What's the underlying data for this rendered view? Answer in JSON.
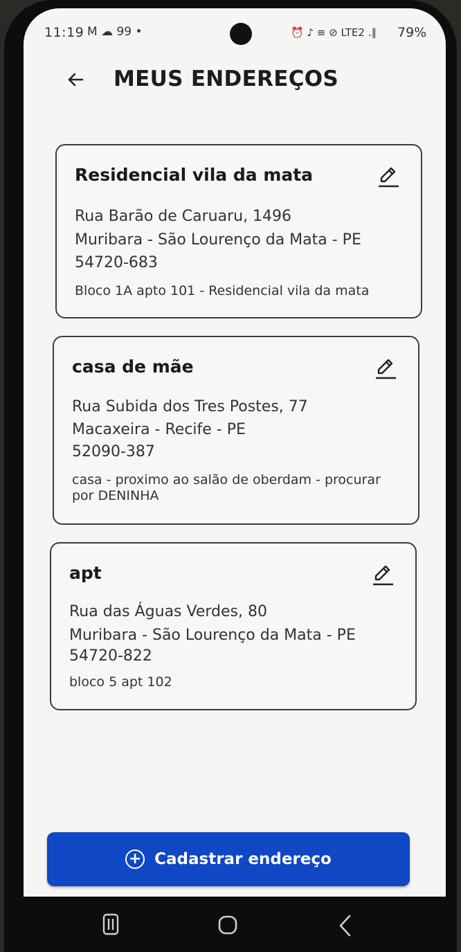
{
  "status_bar": {
    "time": "11:19",
    "notifications": "M ☁ 99 •",
    "system_icons": "⏰ ♪ ≡ ⊘ LTE2 .∥",
    "battery": "79%"
  },
  "header": {
    "title": "MEUS ENDEREÇOS"
  },
  "addresses": [
    {
      "name": "Residencial vila da mata",
      "street": "Rua Barão de Caruaru, 1496",
      "city": "Muribara - São Lourenço da Mata - PE",
      "zip": "54720-683",
      "complement": "Bloco 1A apto 101 - Residencial vila da mata"
    },
    {
      "name": "casa de mãe",
      "street": "Rua Subida dos Tres Postes, 77",
      "city": "Macaxeira - Recife - PE",
      "zip": "52090-387",
      "complement": "casa - proximo ao salão de oberdam - procurar por DENINHA"
    },
    {
      "name": "apt",
      "street": "Rua das Águas Verdes, 80",
      "city": "Muribara - São Lourenço da Mata - PE",
      "zip": "54720-822",
      "complement": "bloco 5 apt 102"
    }
  ],
  "actions": {
    "add_address_label": "Cadastrar endereço"
  },
  "icons": {
    "back": "arrow-left-icon",
    "edit": "pencil-icon",
    "add": "plus-circle-icon",
    "nav_recent": "recent-apps-icon",
    "nav_home": "home-icon",
    "nav_back": "chevron-left-icon"
  },
  "colors": {
    "primary_button": "#0f47c4",
    "card_border": "#3a3d45",
    "background": "#f5f5f3"
  }
}
